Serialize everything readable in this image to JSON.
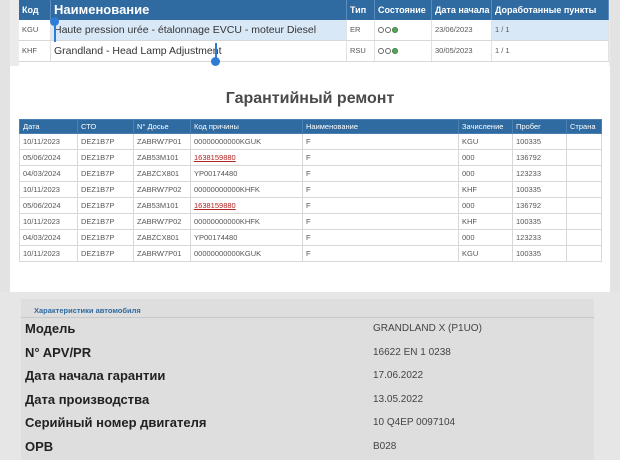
{
  "top_grid": {
    "headers": {
      "kod": "Код",
      "name": "Наименование",
      "type": "Тип",
      "state": "Состояние",
      "start_date": "Дата начала",
      "points": "Доработанные пункты"
    },
    "rows": [
      {
        "kod": "KGU",
        "name": "Haute pression urée - étalonnage EVCU - moteur Diesel",
        "type": "ER",
        "state": "two-white-one-green",
        "start_date": "23/06/2023",
        "points": "1 / 1",
        "selected": true
      },
      {
        "kod": "KHF",
        "name": "Grandland - Head Lamp Adjustment",
        "type": "RSU",
        "state": "two-white-one-green",
        "start_date": "30/05/2023",
        "points": "1 / 1",
        "selected": false
      }
    ]
  },
  "warranty": {
    "title": "Гарантийный ремонт",
    "headers": [
      "Дата",
      "СТО",
      "N° Досье",
      "Код причины",
      "Наименование",
      "Зачисление",
      "Пробег",
      "Страна"
    ],
    "rows": [
      [
        "10/11/2023",
        "DEZ1B7P",
        "ZABRW7P01",
        "00000000000KGUK",
        "F",
        "KGU",
        "100335",
        ""
      ],
      [
        "05/06/2024",
        "DEZ1B7P",
        "ZAB53M101",
        "1638159880",
        "F",
        "000",
        "136792",
        ""
      ],
      [
        "04/03/2024",
        "DEZ1B7P",
        "ZABZCX801",
        "YP00174480",
        "F",
        "000",
        "123233",
        ""
      ],
      [
        "10/11/2023",
        "DEZ1B7P",
        "ZABRW7P02",
        "00000000000KHFK",
        "F",
        "KHF",
        "100335",
        ""
      ],
      [
        "05/06/2024",
        "DEZ1B7P",
        "ZAB53M101",
        "1638159880",
        "F",
        "000",
        "136792",
        ""
      ],
      [
        "10/11/2023",
        "DEZ1B7P",
        "ZABRW7P02",
        "00000000000KHFK",
        "F",
        "KHF",
        "100335",
        ""
      ],
      [
        "04/03/2024",
        "DEZ1B7P",
        "ZABZCX801",
        "YP00174480",
        "F",
        "000",
        "123233",
        ""
      ],
      [
        "10/11/2023",
        "DEZ1B7P",
        "ZABRW7P01",
        "00000000000KGUK",
        "F",
        "KGU",
        "100335",
        ""
      ]
    ],
    "link_code": "1638159880"
  },
  "vehicle": {
    "title": "Характеристики автомобиля",
    "items": [
      {
        "label": "Модель",
        "value": "GRANDLAND X (P1UO)"
      },
      {
        "label": "N° APV/PR",
        "value": "16622 EN 1 0238"
      },
      {
        "label": "Дата начала гарантии",
        "value": "17.06.2022"
      },
      {
        "label": "Дата производства",
        "value": "13.05.2022"
      },
      {
        "label": "Серийный номер двигателя",
        "value": "10 Q4EP 0097104"
      },
      {
        "label": "OPB",
        "value": "B028"
      }
    ]
  },
  "colors": {
    "header": "#2f6aa0",
    "link": "#b02020",
    "selection": "#2d7cd6"
  }
}
